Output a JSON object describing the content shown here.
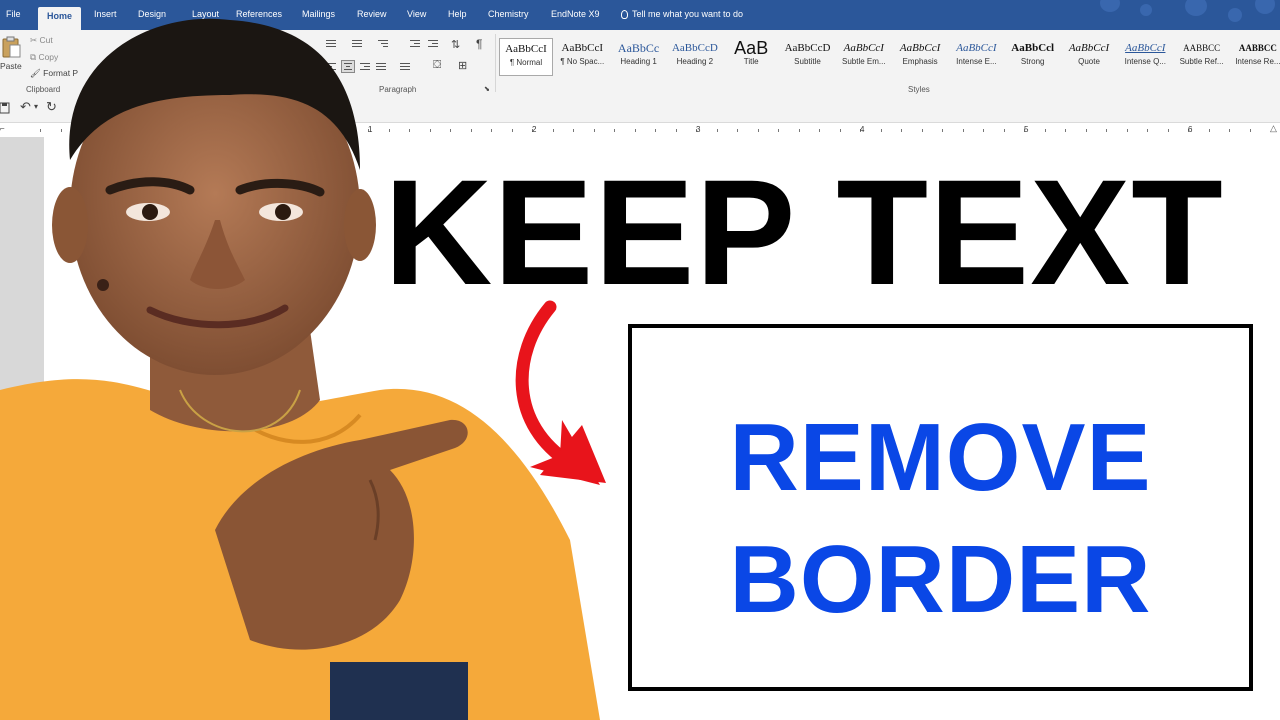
{
  "tabs": [
    "File",
    "Home",
    "Insert",
    "Design",
    "Layout",
    "References",
    "Mailings",
    "Review",
    "View",
    "Help",
    "Chemistry",
    "EndNote X9"
  ],
  "tell_me": "Tell me what you want to do",
  "clipboard": {
    "paste": "Paste",
    "cut": "Cut",
    "copy": "Copy",
    "format_painter": "Format P",
    "label": "Clipboard"
  },
  "paragraph_label": "Paragraph",
  "styles_label": "Styles",
  "styles": [
    {
      "sample": "AaBbCcI",
      "name": "¶ Normal"
    },
    {
      "sample": "AaBbCcI",
      "name": "¶ No Spac..."
    },
    {
      "sample": "AaBbCc",
      "name": "Heading 1"
    },
    {
      "sample": "AaBbCcD",
      "name": "Heading 2"
    },
    {
      "sample": "AaB",
      "name": "Title"
    },
    {
      "sample": "AaBbCcD",
      "name": "Subtitle"
    },
    {
      "sample": "AaBbCcI",
      "name": "Subtle Em..."
    },
    {
      "sample": "AaBbCcI",
      "name": "Emphasis"
    },
    {
      "sample": "AaBbCcI",
      "name": "Intense E..."
    },
    {
      "sample": "AaBbCcl",
      "name": "Strong"
    },
    {
      "sample": "AaBbCcI",
      "name": "Quote"
    },
    {
      "sample": "AaBbCcI",
      "name": "Intense Q..."
    },
    {
      "sample": "AABBCC",
      "name": "Subtle Ref..."
    },
    {
      "sample": "AABBCC",
      "name": "Intense Re..."
    }
  ],
  "ruler_numbers": [
    "1",
    "2",
    "3",
    "4",
    "5",
    "6"
  ],
  "document": {
    "headline": "KEEP TEXT",
    "box_line1": "REMOVE",
    "box_line2": "BORDER"
  },
  "colors": {
    "accent": "#2b579a",
    "box_text": "#0a47e6",
    "arrow": "#e8141b",
    "shirt": "#f5a93a"
  }
}
